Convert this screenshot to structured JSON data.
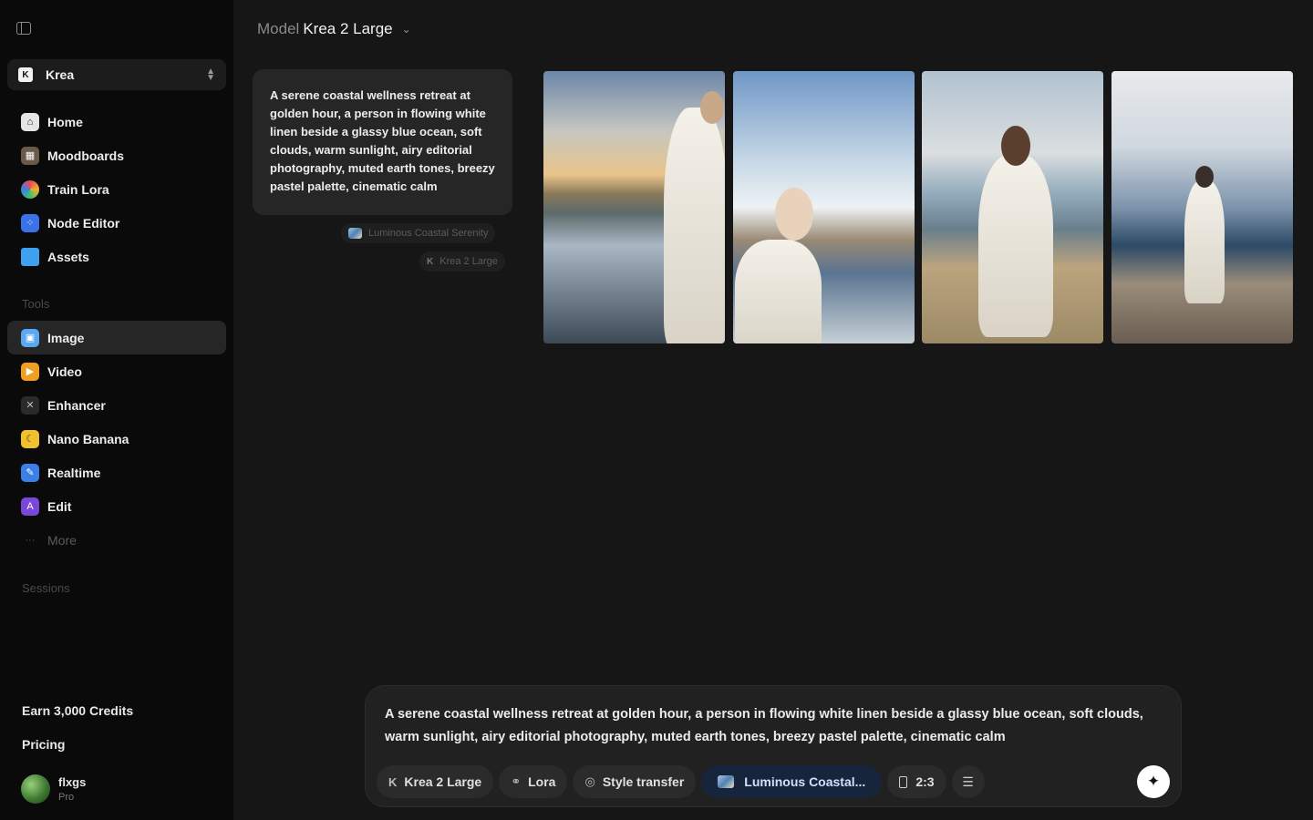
{
  "workspace": {
    "name": "Krea"
  },
  "nav": {
    "main": [
      {
        "label": "Home",
        "icon": "home-icon",
        "color": "#e5e5e5"
      },
      {
        "label": "Moodboards",
        "icon": "moodboard-icon",
        "color": "#6b5a4a"
      },
      {
        "label": "Train Lora",
        "icon": "train-lora-icon",
        "color": "#d84a6a"
      },
      {
        "label": "Node Editor",
        "icon": "node-editor-icon",
        "color": "#3a72e8"
      },
      {
        "label": "Assets",
        "icon": "folder-icon",
        "color": "#3fa0f0"
      }
    ],
    "tools_title": "Tools",
    "tools": [
      {
        "label": "Image",
        "icon": "image-icon",
        "color": "#5aa8f0",
        "active": true
      },
      {
        "label": "Video",
        "icon": "video-icon",
        "color": "#f0a020"
      },
      {
        "label": "Enhancer",
        "icon": "enhancer-icon",
        "color": "#3a3a3a"
      },
      {
        "label": "Nano Banana",
        "icon": "banana-icon",
        "color": "#f0c030"
      },
      {
        "label": "Realtime",
        "icon": "realtime-icon",
        "color": "#3a80e8"
      },
      {
        "label": "Edit",
        "icon": "edit-icon",
        "color": "#7a48d8"
      },
      {
        "label": "More",
        "icon": "more-icon",
        "color": "#0a0a0a"
      }
    ],
    "sessions_title": "Sessions"
  },
  "footer": {
    "earn_credits": "Earn 3,000 Credits",
    "pricing": "Pricing",
    "user_name": "flxgs",
    "user_plan": "Pro"
  },
  "header": {
    "model_prefix": "Model",
    "model_name": "Krea 2 Large"
  },
  "history": {
    "prompt": "A serene coastal wellness retreat at golden hour, a person in flowing white linen beside a glassy blue ocean, soft clouds, warm sunlight, airy editorial photography, muted earth tones, breezy pastel palette, cinematic calm",
    "style_chip": "Luminous Coastal Serenity",
    "model_chip": "Krea 2 Large"
  },
  "gallery": {
    "images": [
      {
        "alt": "generated-image-1"
      },
      {
        "alt": "generated-image-2"
      },
      {
        "alt": "generated-image-3"
      },
      {
        "alt": "generated-image-4"
      }
    ]
  },
  "composer": {
    "text": "A serene coastal wellness retreat at golden hour, a person in flowing white linen beside a glassy blue ocean, soft clouds, warm sunlight, airy editorial photography, muted earth tones, breezy pastel palette, cinematic calm",
    "model_label": "Krea 2 Large",
    "lora_label": "Lora",
    "style_transfer_label": "Style transfer",
    "style_label": "Luminous Coastal...",
    "aspect_ratio_label": "2:3"
  },
  "colors": {
    "sidebar_bg": "#0a0a0a",
    "main_bg": "#161616",
    "accent_chip_bg": "#17253c"
  }
}
